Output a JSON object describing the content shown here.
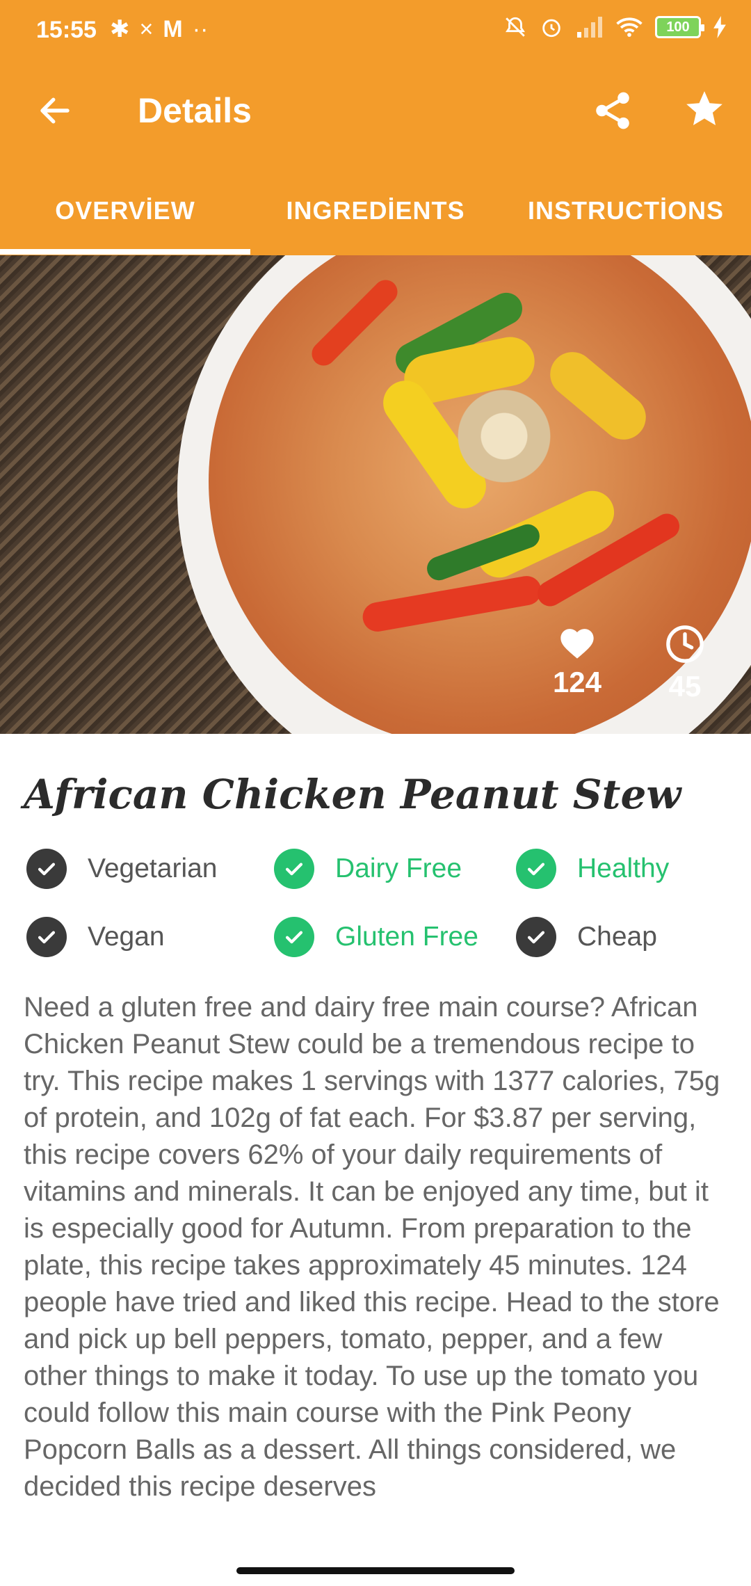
{
  "status_bar": {
    "time": "15:55",
    "left_glyphs": [
      "✱",
      "×",
      "M",
      "··"
    ],
    "battery": "100"
  },
  "toolbar": {
    "title": "Details",
    "icons": [
      "back-arrow-icon",
      "share-icon",
      "star-icon"
    ]
  },
  "tabs": [
    {
      "label": "OVERVİEW",
      "selected": true
    },
    {
      "label": "INGREDİENTS",
      "selected": false
    },
    {
      "label": "INSTRUCTİONS",
      "selected": false
    }
  ],
  "hero": {
    "likes": "124",
    "minutes": "45"
  },
  "recipe": {
    "title": "African Chicken Peanut Stew",
    "tags": [
      {
        "label": "Vegetarian",
        "active": false
      },
      {
        "label": "Dairy Free",
        "active": true
      },
      {
        "label": "Healthy",
        "active": true
      },
      {
        "label": "Vegan",
        "active": false
      },
      {
        "label": "Gluten Free",
        "active": true
      },
      {
        "label": "Cheap",
        "active": false
      }
    ],
    "summary": "Need a gluten free and dairy free main course? African Chicken Peanut Stew could be a tremendous recipe to try. This recipe makes 1 servings with 1377 calories, 75g of protein, and 102g of fat each. For $3.87 per serving, this recipe covers 62% of your daily requirements of vitamins and minerals. It can be enjoyed any time, but it is especially good for Autumn. From preparation to the plate, this recipe takes approximately 45 minutes. 124 people have tried and liked this recipe. Head to the store and pick up bell peppers, tomato, pepper, and a few other things to make it today. To use up the tomato you could follow this main course with the Pink Peony Popcorn Balls as a dessert. All things considered, we decided this recipe deserves"
  },
  "colors": {
    "primary": "#F39C2B",
    "active_tag": "#25C16F",
    "inactive_tag": "#3A3A3A",
    "body_text": "#666666"
  }
}
